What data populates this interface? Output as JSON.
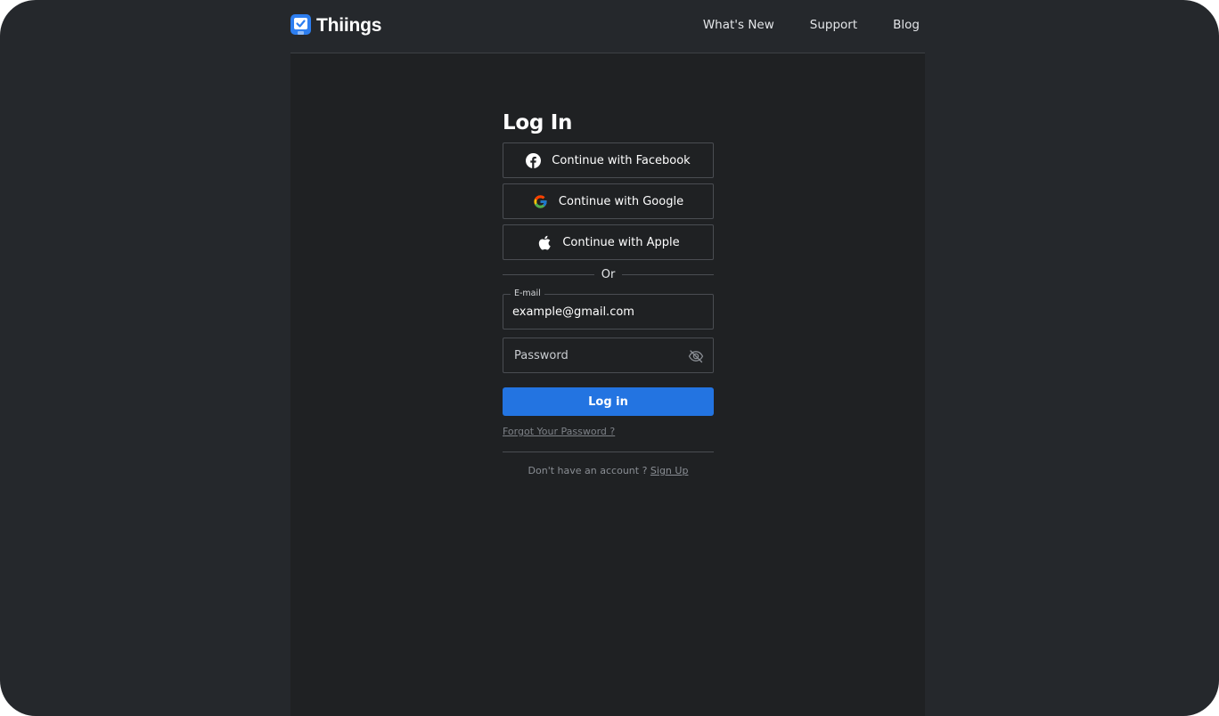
{
  "header": {
    "brand": "Thiings",
    "nav": [
      "What's New",
      "Support",
      "Blog"
    ]
  },
  "login": {
    "title": "Log In",
    "social": [
      {
        "label": "Continue with Facebook",
        "icon": "facebook-icon"
      },
      {
        "label": "Continue with Google",
        "icon": "google-icon"
      },
      {
        "label": "Continue with Apple",
        "icon": "apple-icon"
      }
    ],
    "divider": "Or",
    "email": {
      "label": "E-mail",
      "value": "example@gmail.com"
    },
    "password": {
      "placeholder": "Password",
      "icon": "eye-slash-icon"
    },
    "submit": "Log in",
    "forgot": "Forgot Your Password ?",
    "no_account": "Don't have an account ?",
    "signup": "Sign Up"
  },
  "colors": {
    "background": "#25282c",
    "panel": "#1f2123",
    "accent": "#2374e1",
    "logo": "#2d7ef0"
  }
}
